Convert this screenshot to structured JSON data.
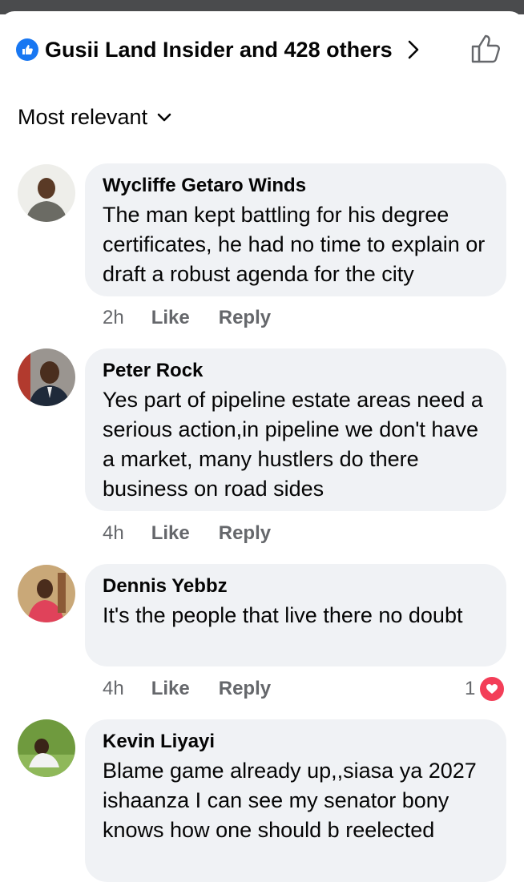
{
  "header": {
    "reactors_text": "Gusii Land Insider and 428 others",
    "reaction_type": "like"
  },
  "sort": {
    "label": "Most relevant"
  },
  "colors": {
    "accent": "#1877f2",
    "bubble": "#f0f2f5",
    "meta": "#65676b",
    "love": "#f33e58"
  },
  "comments": [
    {
      "author": "Wycliffe Getaro Winds",
      "text": "The man kept battling for his degree certificates, he had no time to explain or draft a robust agenda for the city",
      "time": "2h",
      "like_label": "Like",
      "reply_label": "Reply"
    },
    {
      "author": "Peter Rock",
      "text": "Yes part of pipeline estate areas need a serious action,in pipeline we don't have a market, many hustlers do there business on road sides",
      "time": "4h",
      "like_label": "Like",
      "reply_label": "Reply"
    },
    {
      "author": "Dennis Yebbz",
      "text": "It's the people that live there no doubt",
      "time": "4h",
      "like_label": "Like",
      "reply_label": "Reply",
      "reactions": {
        "count": "1",
        "type": "love"
      }
    },
    {
      "author": "Kevin Liyayi",
      "text": "Blame game already up,,siasa ya 2027 ishaanza I can see my senator bony knows how one should b reelected",
      "time": "",
      "like_label": "",
      "reply_label": ""
    }
  ]
}
